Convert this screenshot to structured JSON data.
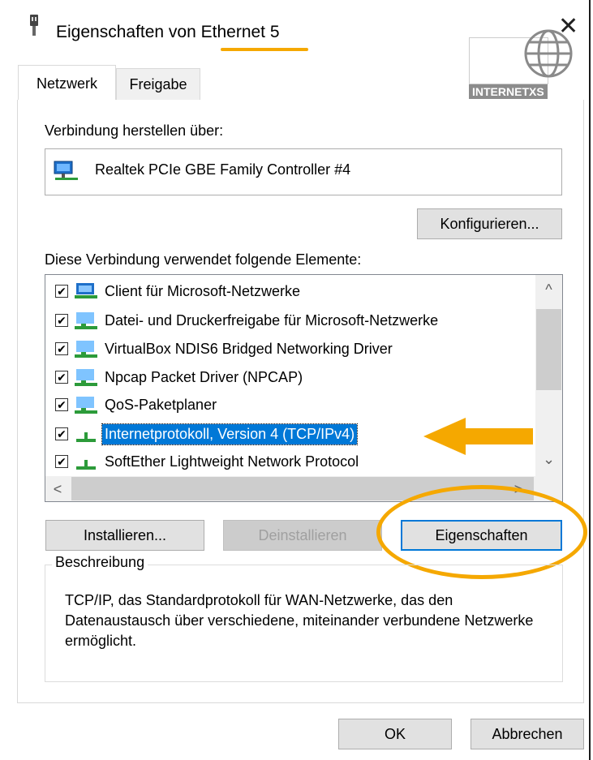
{
  "window": {
    "title": "Eigenschaften von Ethernet 5",
    "close_glyph": "✕",
    "watermark": "INTERNETXS"
  },
  "tabs": [
    {
      "label": "Netzwerk",
      "active": true
    },
    {
      "label": "Freigabe",
      "active": false
    }
  ],
  "connect_via": {
    "label": "Verbindung herstellen über:",
    "adapter": "Realtek PCIe GBE Family Controller #4",
    "adapter_icon": "network-adapter-icon"
  },
  "configure_button": "Konfigurieren...",
  "elements_label": "Diese Verbindung verwendet folgende Elemente:",
  "elements": [
    {
      "label": "Client für Microsoft-Netzwerke",
      "checked": true,
      "selected": false,
      "icon": "network-client-icon"
    },
    {
      "label": "Datei- und Druckerfreigabe für Microsoft-Netzwerke",
      "checked": true,
      "selected": false,
      "icon": "network-service-icon"
    },
    {
      "label": "VirtualBox NDIS6 Bridged Networking Driver",
      "checked": true,
      "selected": false,
      "icon": "network-service-icon"
    },
    {
      "label": "Npcap Packet Driver (NPCAP)",
      "checked": true,
      "selected": false,
      "icon": "network-service-icon"
    },
    {
      "label": "QoS-Paketplaner",
      "checked": true,
      "selected": false,
      "icon": "network-service-icon"
    },
    {
      "label": "Internetprotokoll, Version 4 (TCP/IPv4)",
      "checked": true,
      "selected": true,
      "icon": "protocol-icon"
    },
    {
      "label": "SoftEther Lightweight Network Protocol",
      "checked": true,
      "selected": false,
      "icon": "protocol-icon"
    }
  ],
  "scroll_glyphs": {
    "up": "^",
    "down": "⌄",
    "left": "<",
    "right": ">"
  },
  "checkmark_glyph": "✔",
  "buttons": {
    "install": "Installieren...",
    "uninstall": "Deinstallieren",
    "properties": "Eigenschaften",
    "ok": "OK",
    "cancel": "Abbrechen"
  },
  "description": {
    "legend": "Beschreibung",
    "text": "TCP/IP, das Standardprotokoll für WAN-Netzwerke, das den Datenaustausch über verschiedene, miteinander verbundene Netzwerke ermöglicht."
  },
  "colors": {
    "accent": "#0078d7",
    "highlight_orange": "#f5a800"
  }
}
